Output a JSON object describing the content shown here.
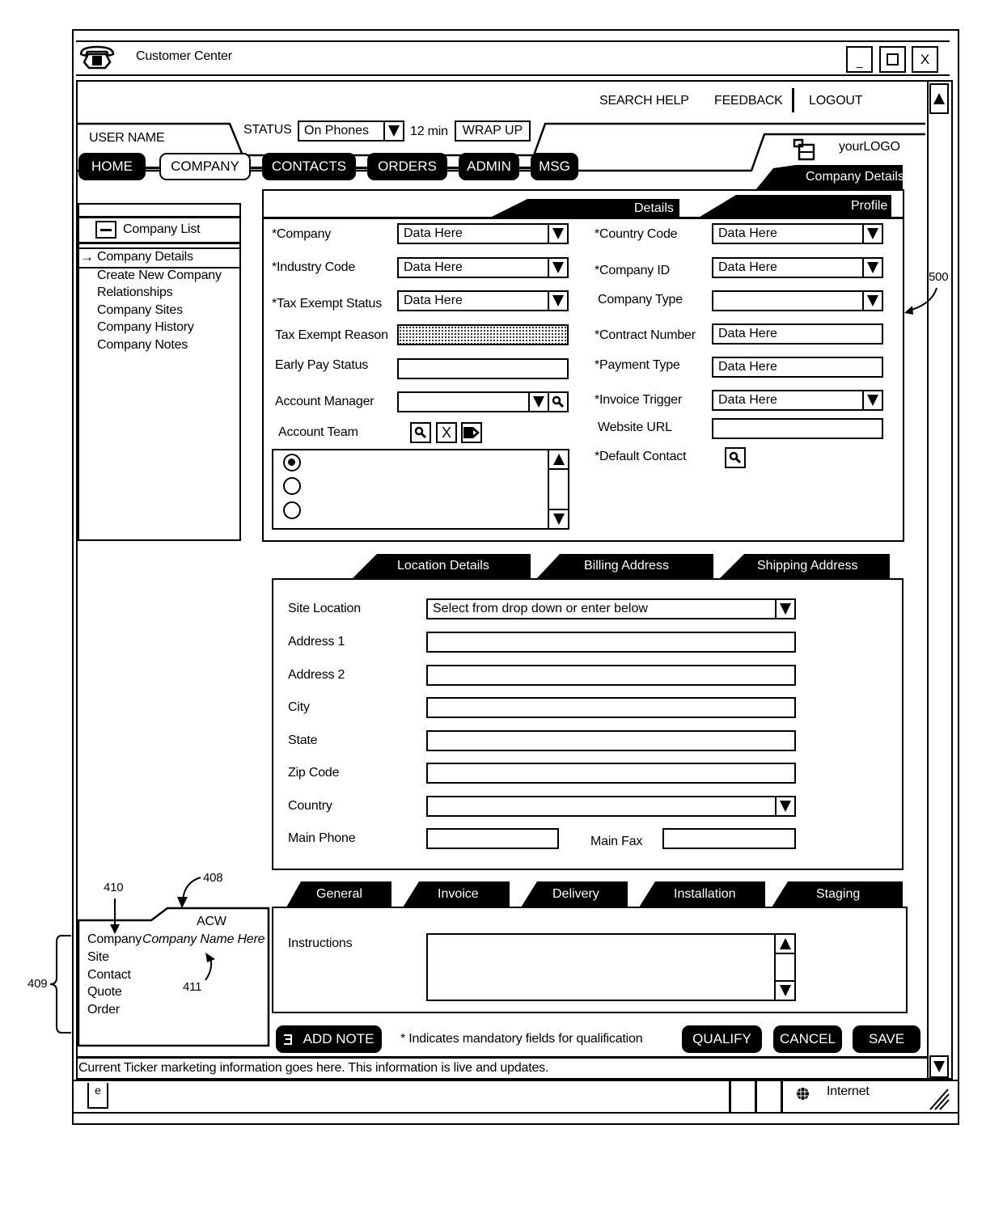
{
  "window": {
    "title": "Customer Center",
    "controls": {
      "minimize": "_",
      "maximize": "☐",
      "close": "X"
    }
  },
  "top_links": {
    "search_help": "SEARCH HELP",
    "feedback": "FEEDBACK",
    "logout": "LOGOUT"
  },
  "header": {
    "user_name": "USER NAME",
    "status_label": "STATUS",
    "status_value": "On Phones",
    "timer": "12 min",
    "wrap_up": "WRAP UP",
    "logo_text": "yourLOGO",
    "page_title_tab": "Company Details"
  },
  "nav": {
    "items": [
      {
        "label": "HOME",
        "active": false
      },
      {
        "label": "COMPANY",
        "active": true
      },
      {
        "label": "CONTACTS",
        "active": false
      },
      {
        "label": "ORDERS",
        "active": false
      },
      {
        "label": "ADMIN",
        "active": false
      },
      {
        "label": "MSG",
        "active": false
      }
    ]
  },
  "sidebar": {
    "list_title": "Company List",
    "selected": "Company Details",
    "items": [
      "Create New Company",
      "Relationships",
      "Company Sites",
      "Company History",
      "Company Notes"
    ]
  },
  "details_tabs": [
    "Details",
    "Profile"
  ],
  "details_form": {
    "left": [
      {
        "label": "*Company",
        "value": "Data Here",
        "type": "dropdown"
      },
      {
        "label": "*Industry Code",
        "value": "Data Here",
        "type": "dropdown"
      },
      {
        "label": "*Tax Exempt Status",
        "value": "Data Here",
        "type": "dropdown"
      },
      {
        "label": "Tax Exempt Reason",
        "value": "",
        "type": "disabled"
      },
      {
        "label": "Early Pay Status",
        "value": "",
        "type": "text"
      },
      {
        "label": "Account Manager",
        "value": "",
        "type": "dropdown-search"
      },
      {
        "label": "Account Team",
        "value": "",
        "type": "icons"
      }
    ],
    "right": [
      {
        "label": "*Country Code",
        "value": "Data Here",
        "type": "dropdown"
      },
      {
        "label": "*Company ID",
        "value": "Data Here",
        "type": "dropdown"
      },
      {
        "label": "Company Type",
        "value": "",
        "type": "dropdown"
      },
      {
        "label": "*Contract Number",
        "value": "Data Here",
        "type": "text"
      },
      {
        "label": "*Payment Type",
        "value": "Data Here",
        "type": "text"
      },
      {
        "label": "*Invoice Trigger",
        "value": "Data Here",
        "type": "dropdown"
      },
      {
        "label": "Website URL",
        "value": "",
        "type": "text"
      },
      {
        "label": "*Default Contact",
        "value": "",
        "type": "search"
      }
    ],
    "account_team_radios": [
      true,
      false,
      false
    ]
  },
  "address_tabs": [
    "Location Details",
    "Billing Address",
    "Shipping Address"
  ],
  "address_form": {
    "site_location_label": "Site Location",
    "site_location_value": "Select from drop down or enter below",
    "address1": "Address 1",
    "address2": "Address 2",
    "city": "City",
    "state": "State",
    "zip": "Zip Code",
    "country": "Country",
    "main_phone": "Main Phone",
    "main_fax": "Main Fax"
  },
  "notes_tabs": [
    "General",
    "Invoice",
    "Delivery",
    "Installation",
    "Staging"
  ],
  "notes_form": {
    "instructions_label": "Instructions",
    "instructions_value": ""
  },
  "acw": {
    "title": "ACW",
    "rows": [
      "Company",
      "Site",
      "Contact",
      "Quote",
      "Order"
    ],
    "company_name": "Company Name Here"
  },
  "annotations": {
    "a408": "408",
    "a409": "409",
    "a410": "410",
    "a411": "411",
    "a500": "500"
  },
  "actions": {
    "add_note": "ADD NOTE",
    "mandatory_note": "* Indicates mandatory fields for qualification",
    "qualify": "QUALIFY",
    "cancel": "CANCEL",
    "save": "SAVE"
  },
  "ticker": "Current Ticker marketing information goes here. This information is live and updates.",
  "statusbar": {
    "zone": "Internet",
    "page_icon_letter": "e"
  }
}
